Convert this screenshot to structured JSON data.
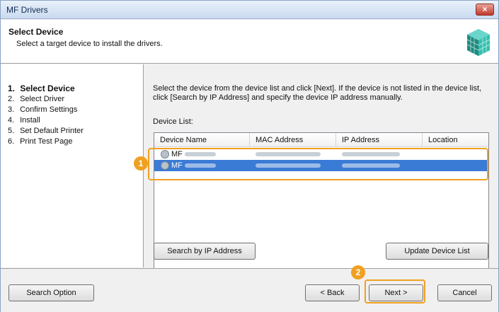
{
  "window": {
    "title": "MF Drivers",
    "close_glyph": "×"
  },
  "header": {
    "title": "Select Device",
    "subtitle": "Select a target device to install the drivers."
  },
  "steps": [
    {
      "num": "1.",
      "label": "Select Device",
      "active": true
    },
    {
      "num": "2.",
      "label": "Select Driver"
    },
    {
      "num": "3.",
      "label": "Confirm Settings"
    },
    {
      "num": "4.",
      "label": "Install"
    },
    {
      "num": "5.",
      "label": "Set Default Printer"
    },
    {
      "num": "6.",
      "label": "Print Test Page"
    }
  ],
  "main": {
    "instructions": "Select the device from the device list and click [Next]. If the device is not listed in the device list, click [Search by IP Address] and specify the device IP address manually.",
    "list_label": "Device List:",
    "columns": [
      "Device Name",
      "MAC Address",
      "IP Address",
      "Location"
    ],
    "rows": [
      {
        "name_prefix": "MF",
        "selected": false
      },
      {
        "name_prefix": "MF",
        "selected": true
      }
    ],
    "search_ip_button": "Search by IP Address",
    "update_list_button": "Update Device List"
  },
  "footer": {
    "search_option_button": "Search Option",
    "back_button": "< Back",
    "next_button": "Next >",
    "cancel_button": "Cancel"
  },
  "callouts": {
    "one": "1",
    "two": "2"
  },
  "colors": {
    "highlight": "#f0a020",
    "selection": "#3a7bd5"
  }
}
